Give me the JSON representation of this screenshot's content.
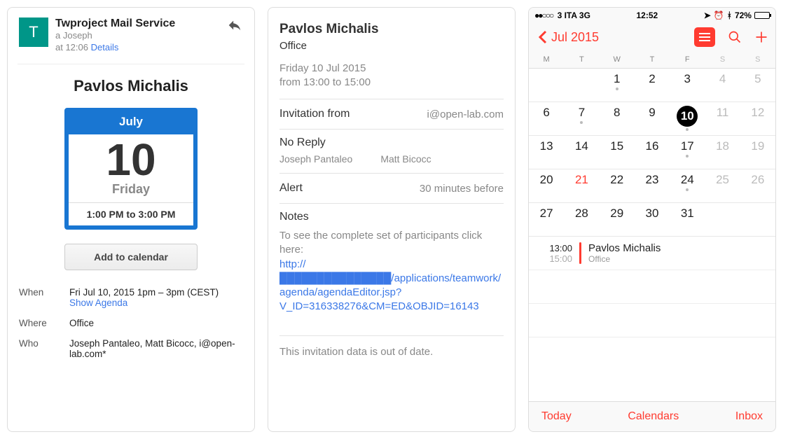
{
  "mail": {
    "avatar_letter": "T",
    "sender": "Twproject Mail Service",
    "to_line": "a Joseph",
    "time_prefix": "at 12:06",
    "details_link": "Details",
    "title": "Pavlos Michalis",
    "card": {
      "month": "July",
      "day": "10",
      "weekday": "Friday",
      "time_range": "1:00 PM to 3:00 PM"
    },
    "add_button": "Add to calendar",
    "when_label": "When",
    "when_value": "Fri Jul 10, 2015 1pm – 3pm (CEST)",
    "show_agenda": "Show Agenda",
    "where_label": "Where",
    "where_value": "Office",
    "who_label": "Who",
    "who_value": "Joseph Pantaleo, Matt Bicocc, i@open-lab.com*"
  },
  "event": {
    "title": "Pavlos Michalis",
    "location": "Office",
    "date_line1": "Friday 10 Jul 2015",
    "date_line2": "from 13:00 to 15:00",
    "inv_label": "Invitation from",
    "inv_value": "i@open-lab.com",
    "noreply_label": "No Reply",
    "noreply_p1": "Joseph Pantaleo",
    "noreply_p2": "Matt Bicocc",
    "alert_label": "Alert",
    "alert_value": "30 minutes before",
    "notes_label": "Notes",
    "notes_text": "To see the complete set of participants click here:",
    "notes_link": "http://███████████████/applications/teamwork/agenda/agendaEditor.jsp?V_ID=316338276&CM=ED&OBJID=16143",
    "footer": "This invitation data is out of date."
  },
  "ios": {
    "status": {
      "carrier": "3 ITA  3G",
      "time": "12:52",
      "battery": "72%"
    },
    "nav_back": "Jul 2015",
    "weekdays": [
      "M",
      "T",
      "W",
      "T",
      "F",
      "S",
      "S"
    ],
    "days": [
      {
        "n": "",
        "cls": "blank"
      },
      {
        "n": "",
        "cls": "blank"
      },
      {
        "n": "1",
        "dot": true
      },
      {
        "n": "2"
      },
      {
        "n": "3"
      },
      {
        "n": "4",
        "cls": "wknd"
      },
      {
        "n": "5",
        "cls": "wknd"
      },
      {
        "n": "6"
      },
      {
        "n": "7",
        "dot": true
      },
      {
        "n": "8"
      },
      {
        "n": "9"
      },
      {
        "n": "10",
        "cls": "sel",
        "dot": true
      },
      {
        "n": "11",
        "cls": "wknd"
      },
      {
        "n": "12",
        "cls": "wknd"
      },
      {
        "n": "13"
      },
      {
        "n": "14"
      },
      {
        "n": "15"
      },
      {
        "n": "16"
      },
      {
        "n": "17",
        "dot": true
      },
      {
        "n": "18",
        "cls": "wknd"
      },
      {
        "n": "19",
        "cls": "wknd"
      },
      {
        "n": "20"
      },
      {
        "n": "21",
        "cls": "today"
      },
      {
        "n": "22"
      },
      {
        "n": "23"
      },
      {
        "n": "24",
        "dot": true
      },
      {
        "n": "25",
        "cls": "wknd"
      },
      {
        "n": "26",
        "cls": "wknd"
      },
      {
        "n": "27"
      },
      {
        "n": "28"
      },
      {
        "n": "29"
      },
      {
        "n": "30"
      },
      {
        "n": "31"
      },
      {
        "n": "",
        "cls": "blank"
      },
      {
        "n": "",
        "cls": "blank"
      }
    ],
    "event": {
      "t1": "13:00",
      "t2": "15:00",
      "title": "Pavlos Michalis",
      "loc": "Office"
    },
    "toolbar": {
      "today": "Today",
      "calendars": "Calendars",
      "inbox": "Inbox"
    }
  }
}
